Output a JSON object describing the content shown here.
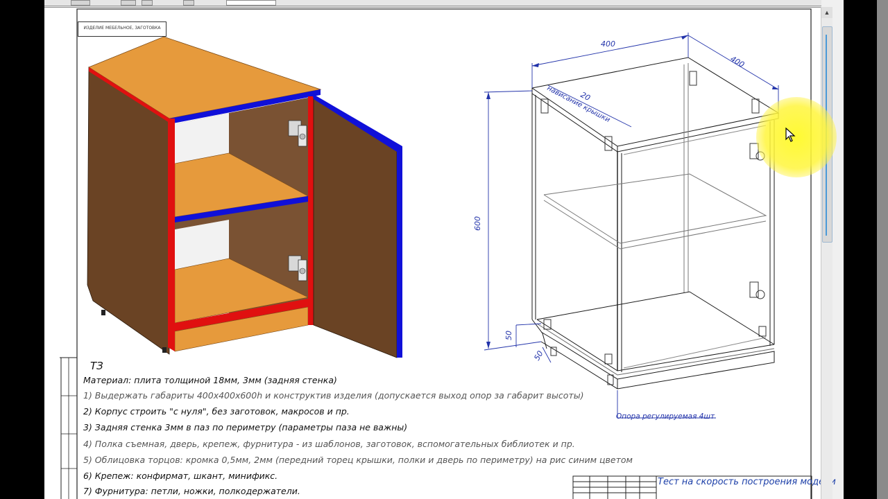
{
  "window": {
    "toolbar_buttons": [
      "btn1",
      "btn2",
      "btn3",
      "btn4",
      "btn5"
    ]
  },
  "stamp": {
    "corner_text": "ИЗДЕЛИЕ МЕБЕЛЬНОЕ, ЗАГОТОВКА"
  },
  "drawing": {
    "dimensions": {
      "width": "400",
      "depth": "400",
      "height": "600",
      "overhang": "20",
      "overhang_label": "нависание крышки",
      "plinth_height": "50",
      "plinth_depth": "50"
    },
    "callout": "Опора регулируемая 4шт",
    "colors": {
      "edge_red": "#e01010",
      "edge_blue": "#1010d8",
      "wood_top": "#e69a3c",
      "wood_side": "#6a4324",
      "wood_inside": "#7a5233",
      "line": "#1a1a1a",
      "dim": "#2233aa"
    }
  },
  "spec": {
    "title": "ТЗ",
    "lines": [
      "Материал: плита толщиной 18мм, 3мм (задняя стенка)",
      "1) Выдержать габариты 400x400x600h и конструктив изделия (допускается выход опор за габарит высоты)",
      "2) Корпус строить \"с нуля\", без заготовок, макросов и пр.",
      "3) Задняя стенка 3мм в паз по периметру (параметры паза не важны)",
      "4) Полка съемная, дверь, крепеж, фурнитура - из шаблонов, заготовок, вспомогательных библиотек и пр.",
      "5) Облицовка торцов: кромка 0,5мм, 2мм (передний торец крышки, полки и дверь по периметру) на рис синим цветом",
      "6) Крепеж: конфирмат, шкант, минификс.",
      "7) Фурнитура: петли, ножки, полкодержатели."
    ]
  },
  "title_block": {
    "caption": "Тест на скорость построения модели"
  }
}
